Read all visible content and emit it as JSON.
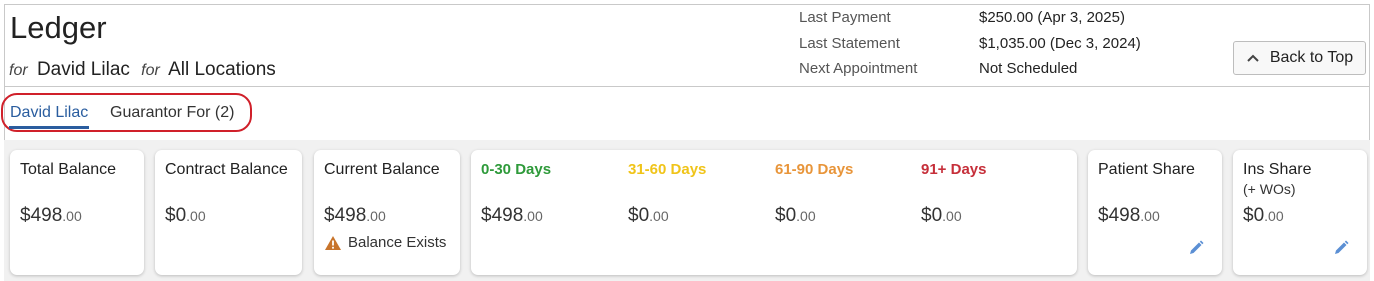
{
  "header": {
    "title": "Ledger",
    "for_word": "for",
    "patient_name": "David Lilac",
    "for_word2": "for",
    "location": "All Locations"
  },
  "meta": [
    {
      "label": "Last Payment",
      "value": "$250.00 (Apr 3, 2025)"
    },
    {
      "label": "Last Statement",
      "value": "$1,035.00 (Dec 3, 2024)"
    },
    {
      "label": "Next Appointment",
      "value": "Not Scheduled"
    }
  ],
  "back_to_top": {
    "label": "Back to Top",
    "icon": "chevron-up-icon"
  },
  "tabs": [
    {
      "label": "David Lilac",
      "active": true
    },
    {
      "label": "Guarantor For (2)",
      "active": false
    }
  ],
  "highlight_color": "#d0202a",
  "accent_color": "#2a5d9f",
  "cards": {
    "total_balance": {
      "label": "Total Balance",
      "dollars": "$498",
      "cents": ".00"
    },
    "contract_balance": {
      "label": "Contract Balance",
      "dollars": "$0",
      "cents": ".00"
    },
    "current_balance": {
      "label": "Current Balance",
      "dollars": "$498",
      "cents": ".00",
      "warning": "Balance Exists",
      "warning_icon": "warning-triangle-icon"
    },
    "patient_share": {
      "label": "Patient Share",
      "dollars": "$498",
      "cents": ".00",
      "icon": "pencil-icon"
    },
    "ins_share": {
      "label": "Ins Share",
      "sublabel": "(+ WOs)",
      "dollars": "$0",
      "cents": ".00",
      "icon": "pencil-icon"
    }
  },
  "aging": [
    {
      "label": "0-30 Days",
      "color": "#2e9a3a",
      "dollars": "$498",
      "cents": ".00"
    },
    {
      "label": "31-60 Days",
      "color": "#f0c419",
      "dollars": "$0",
      "cents": ".00"
    },
    {
      "label": "61-90 Days",
      "color": "#e8953a",
      "dollars": "$0",
      "cents": ".00"
    },
    {
      "label": "91+ Days",
      "color": "#c62f3a",
      "dollars": "$0",
      "cents": ".00"
    }
  ]
}
